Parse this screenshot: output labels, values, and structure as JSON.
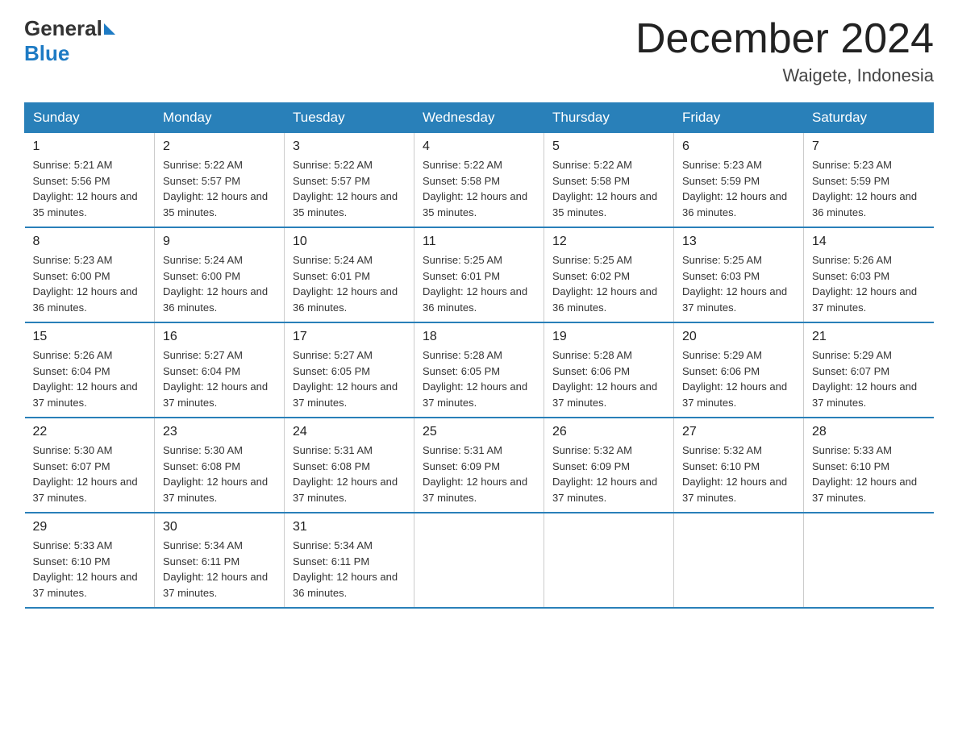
{
  "header": {
    "logo_general": "General",
    "logo_blue": "Blue",
    "month_title": "December 2024",
    "location": "Waigete, Indonesia"
  },
  "days_of_week": [
    "Sunday",
    "Monday",
    "Tuesday",
    "Wednesday",
    "Thursday",
    "Friday",
    "Saturday"
  ],
  "weeks": [
    [
      {
        "day": "1",
        "sunrise": "Sunrise: 5:21 AM",
        "sunset": "Sunset: 5:56 PM",
        "daylight": "Daylight: 12 hours and 35 minutes."
      },
      {
        "day": "2",
        "sunrise": "Sunrise: 5:22 AM",
        "sunset": "Sunset: 5:57 PM",
        "daylight": "Daylight: 12 hours and 35 minutes."
      },
      {
        "day": "3",
        "sunrise": "Sunrise: 5:22 AM",
        "sunset": "Sunset: 5:57 PM",
        "daylight": "Daylight: 12 hours and 35 minutes."
      },
      {
        "day": "4",
        "sunrise": "Sunrise: 5:22 AM",
        "sunset": "Sunset: 5:58 PM",
        "daylight": "Daylight: 12 hours and 35 minutes."
      },
      {
        "day": "5",
        "sunrise": "Sunrise: 5:22 AM",
        "sunset": "Sunset: 5:58 PM",
        "daylight": "Daylight: 12 hours and 35 minutes."
      },
      {
        "day": "6",
        "sunrise": "Sunrise: 5:23 AM",
        "sunset": "Sunset: 5:59 PM",
        "daylight": "Daylight: 12 hours and 36 minutes."
      },
      {
        "day": "7",
        "sunrise": "Sunrise: 5:23 AM",
        "sunset": "Sunset: 5:59 PM",
        "daylight": "Daylight: 12 hours and 36 minutes."
      }
    ],
    [
      {
        "day": "8",
        "sunrise": "Sunrise: 5:23 AM",
        "sunset": "Sunset: 6:00 PM",
        "daylight": "Daylight: 12 hours and 36 minutes."
      },
      {
        "day": "9",
        "sunrise": "Sunrise: 5:24 AM",
        "sunset": "Sunset: 6:00 PM",
        "daylight": "Daylight: 12 hours and 36 minutes."
      },
      {
        "day": "10",
        "sunrise": "Sunrise: 5:24 AM",
        "sunset": "Sunset: 6:01 PM",
        "daylight": "Daylight: 12 hours and 36 minutes."
      },
      {
        "day": "11",
        "sunrise": "Sunrise: 5:25 AM",
        "sunset": "Sunset: 6:01 PM",
        "daylight": "Daylight: 12 hours and 36 minutes."
      },
      {
        "day": "12",
        "sunrise": "Sunrise: 5:25 AM",
        "sunset": "Sunset: 6:02 PM",
        "daylight": "Daylight: 12 hours and 36 minutes."
      },
      {
        "day": "13",
        "sunrise": "Sunrise: 5:25 AM",
        "sunset": "Sunset: 6:03 PM",
        "daylight": "Daylight: 12 hours and 37 minutes."
      },
      {
        "day": "14",
        "sunrise": "Sunrise: 5:26 AM",
        "sunset": "Sunset: 6:03 PM",
        "daylight": "Daylight: 12 hours and 37 minutes."
      }
    ],
    [
      {
        "day": "15",
        "sunrise": "Sunrise: 5:26 AM",
        "sunset": "Sunset: 6:04 PM",
        "daylight": "Daylight: 12 hours and 37 minutes."
      },
      {
        "day": "16",
        "sunrise": "Sunrise: 5:27 AM",
        "sunset": "Sunset: 6:04 PM",
        "daylight": "Daylight: 12 hours and 37 minutes."
      },
      {
        "day": "17",
        "sunrise": "Sunrise: 5:27 AM",
        "sunset": "Sunset: 6:05 PM",
        "daylight": "Daylight: 12 hours and 37 minutes."
      },
      {
        "day": "18",
        "sunrise": "Sunrise: 5:28 AM",
        "sunset": "Sunset: 6:05 PM",
        "daylight": "Daylight: 12 hours and 37 minutes."
      },
      {
        "day": "19",
        "sunrise": "Sunrise: 5:28 AM",
        "sunset": "Sunset: 6:06 PM",
        "daylight": "Daylight: 12 hours and 37 minutes."
      },
      {
        "day": "20",
        "sunrise": "Sunrise: 5:29 AM",
        "sunset": "Sunset: 6:06 PM",
        "daylight": "Daylight: 12 hours and 37 minutes."
      },
      {
        "day": "21",
        "sunrise": "Sunrise: 5:29 AM",
        "sunset": "Sunset: 6:07 PM",
        "daylight": "Daylight: 12 hours and 37 minutes."
      }
    ],
    [
      {
        "day": "22",
        "sunrise": "Sunrise: 5:30 AM",
        "sunset": "Sunset: 6:07 PM",
        "daylight": "Daylight: 12 hours and 37 minutes."
      },
      {
        "day": "23",
        "sunrise": "Sunrise: 5:30 AM",
        "sunset": "Sunset: 6:08 PM",
        "daylight": "Daylight: 12 hours and 37 minutes."
      },
      {
        "day": "24",
        "sunrise": "Sunrise: 5:31 AM",
        "sunset": "Sunset: 6:08 PM",
        "daylight": "Daylight: 12 hours and 37 minutes."
      },
      {
        "day": "25",
        "sunrise": "Sunrise: 5:31 AM",
        "sunset": "Sunset: 6:09 PM",
        "daylight": "Daylight: 12 hours and 37 minutes."
      },
      {
        "day": "26",
        "sunrise": "Sunrise: 5:32 AM",
        "sunset": "Sunset: 6:09 PM",
        "daylight": "Daylight: 12 hours and 37 minutes."
      },
      {
        "day": "27",
        "sunrise": "Sunrise: 5:32 AM",
        "sunset": "Sunset: 6:10 PM",
        "daylight": "Daylight: 12 hours and 37 minutes."
      },
      {
        "day": "28",
        "sunrise": "Sunrise: 5:33 AM",
        "sunset": "Sunset: 6:10 PM",
        "daylight": "Daylight: 12 hours and 37 minutes."
      }
    ],
    [
      {
        "day": "29",
        "sunrise": "Sunrise: 5:33 AM",
        "sunset": "Sunset: 6:10 PM",
        "daylight": "Daylight: 12 hours and 37 minutes."
      },
      {
        "day": "30",
        "sunrise": "Sunrise: 5:34 AM",
        "sunset": "Sunset: 6:11 PM",
        "daylight": "Daylight: 12 hours and 37 minutes."
      },
      {
        "day": "31",
        "sunrise": "Sunrise: 5:34 AM",
        "sunset": "Sunset: 6:11 PM",
        "daylight": "Daylight: 12 hours and 36 minutes."
      },
      null,
      null,
      null,
      null
    ]
  ]
}
